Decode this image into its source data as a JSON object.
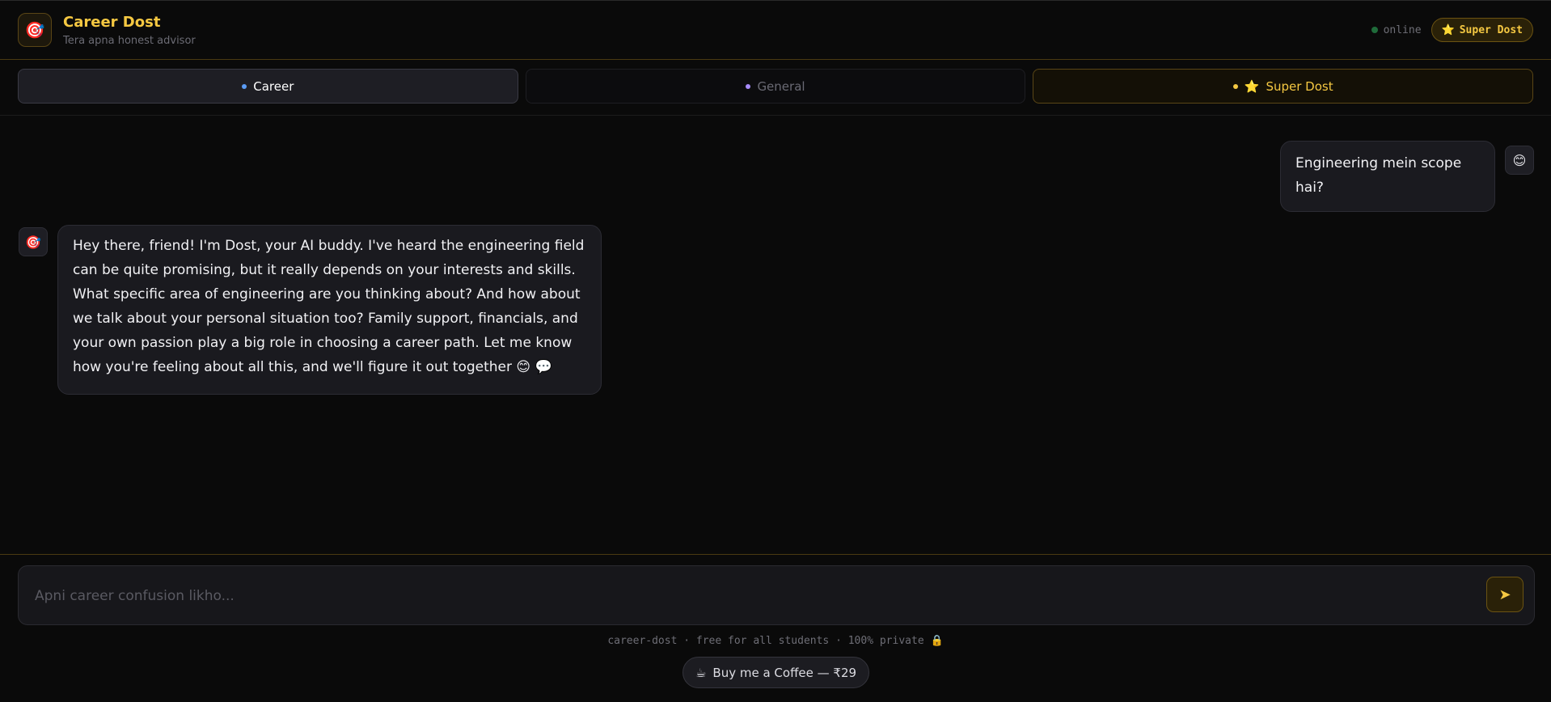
{
  "header": {
    "logo_icon": "🎯",
    "title": "Career Dost",
    "subtitle": "Tera apna honest advisor",
    "status": "online",
    "super_button_icon": "⭐",
    "super_button_label": "Super Dost"
  },
  "tabs": [
    {
      "label": "Career",
      "dot_color": "#5b9cf5",
      "active": true
    },
    {
      "label": "General",
      "dot_color": "#a78bfa",
      "active": false
    },
    {
      "label": "Super Dost",
      "icon": "⭐",
      "dot_color": "#f5c842",
      "active": false
    }
  ],
  "messages": {
    "user": {
      "avatar": "😊",
      "text": "Engineering mein scope hai?"
    },
    "bot": {
      "avatar": "🎯",
      "text": "Hey there, friend! I'm Dost, your AI buddy. I've heard the engineering field can be quite promising, but it really depends on your interests and skills. What specific area of engineering are you thinking about? And how about we talk about your personal situation too? Family support, financials, and your own passion play a big role in choosing a career path. Let me know how you're feeling about all this, and we'll figure it out together 😊 💬"
    }
  },
  "composer": {
    "placeholder": "Apni career confusion likho...",
    "value": "",
    "send_icon": "➤"
  },
  "footer": {
    "note": "career-dost · free for all students · 100% private 🔒",
    "coffee_icon": "☕",
    "coffee_label": "Buy me a Coffee — ₹29"
  },
  "colors": {
    "accent": "#f5c842",
    "background": "#0a0a0a"
  }
}
